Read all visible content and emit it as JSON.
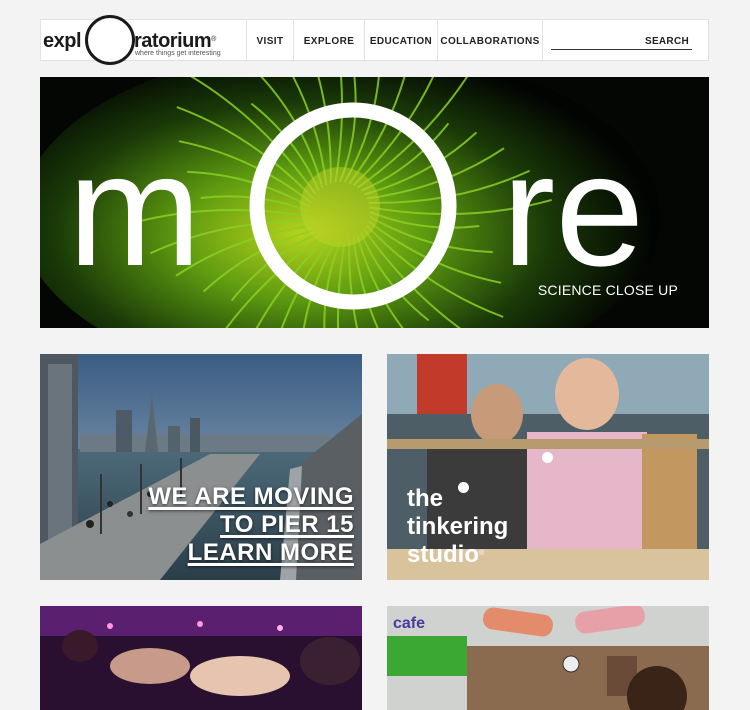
{
  "header": {
    "logo": {
      "left": "expl",
      "right": "ratorium",
      "reg": "®",
      "tagline": "where things get interesting"
    },
    "nav": [
      {
        "label": "VISIT"
      },
      {
        "label": "EXPLORE"
      },
      {
        "label": "EDUCATION"
      },
      {
        "label": "COLLABORATIONS"
      }
    ],
    "search": {
      "label": "SEARCH"
    }
  },
  "hero": {
    "word_left": "m",
    "word_right": "re",
    "subtitle": "SCIENCE CLOSE UP"
  },
  "tiles": {
    "pier": {
      "line1": "WE ARE MOVING",
      "line2": "TO PIER 15",
      "line3": "LEARN MORE"
    },
    "tinkering": {
      "line1": "the",
      "line2": "tinkering",
      "line3": "studio",
      "reg": "®"
    },
    "cafe": {
      "sign": "cafe"
    }
  },
  "colors": {
    "hero_green": "#7cc51a",
    "accent_white": "#ffffff"
  }
}
